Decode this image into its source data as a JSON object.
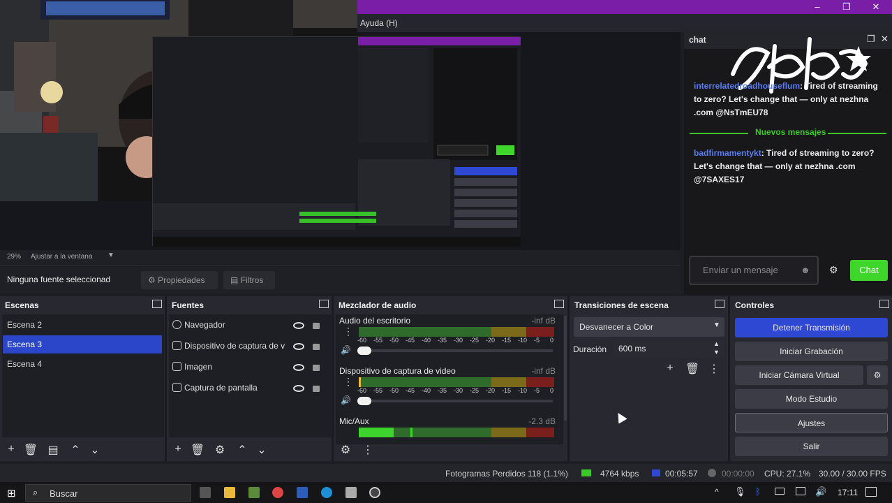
{
  "window": {
    "menu": "Ayuda (H)",
    "win_min": "–",
    "win_max": "❐",
    "win_close": "✕"
  },
  "preview": {
    "zoom_pct": "29%",
    "zoom_mode": "Ajustar a la ventana"
  },
  "source_toolbar": {
    "no_source": "Ninguna fuente seleccionad",
    "props": "Propiedades",
    "filters": "Filtros"
  },
  "chat": {
    "title": "chat",
    "messages": [
      {
        "user": "interrelatedroadhouseflum",
        "text": ": Tired of streaming to zero? Let's change that — only at nezhna .com @NsTmEU78"
      },
      {
        "user": "badfirmamentykt",
        "text": ": Tired of streaming to zero? Let's change that — only at nezhna .com @7SAXES17"
      }
    ],
    "divider": "Nuevos mensajes",
    "input_placeholder": "Enviar un mensaje",
    "send_label": "Chat",
    "logo_text": "BAKA★"
  },
  "scenes": {
    "title": "Escenas",
    "items": [
      "Escena 2",
      "Escena 3",
      "Escena 4"
    ],
    "selected": "Escena 3"
  },
  "sources": {
    "title": "Fuentes",
    "items": [
      "Navegador",
      "Dispositivo de captura de v",
      "Imagen",
      "Captura de pantalla"
    ]
  },
  "mixer": {
    "title": "Mezclador de audio",
    "channels": [
      {
        "name": "Audio del escritorio",
        "level": "-inf dB"
      },
      {
        "name": "Dispositivo de captura de video",
        "level": "-inf dB"
      },
      {
        "name": "Mic/Aux",
        "level": "-2.3 dB"
      }
    ],
    "scale": [
      "-60",
      "-55",
      "-50",
      "-45",
      "-40",
      "-35",
      "-30",
      "-25",
      "-20",
      "-15",
      "-10",
      "-5",
      "0"
    ]
  },
  "transitions": {
    "title": "Transiciones de escena",
    "type": "Desvanecer a Color",
    "duration_label": "Duración",
    "duration_value": "600 ms"
  },
  "controls": {
    "title": "Controles",
    "buttons": [
      "Detener Transmisión",
      "Iniciar Grabación",
      "Iniciar Cámara Virtual",
      "Modo Estudio",
      "Ajustes",
      "Salir"
    ]
  },
  "status": {
    "dropped": "Fotogramas Perdidos 118 (1.1%)",
    "kbps": "4764 kbps",
    "live_time": "00:05:57",
    "rec_time": "00:00:00",
    "cpu": "CPU: 27.1%",
    "fps": "30.00 / 30.00 FPS"
  },
  "taskbar": {
    "search": "Buscar",
    "time": "17:11"
  },
  "colors": {
    "accent": "#2e48d4",
    "titlebar": "#7a1ea8",
    "chat_green": "#3fd62b",
    "chat_user": "#5b7cf5"
  }
}
